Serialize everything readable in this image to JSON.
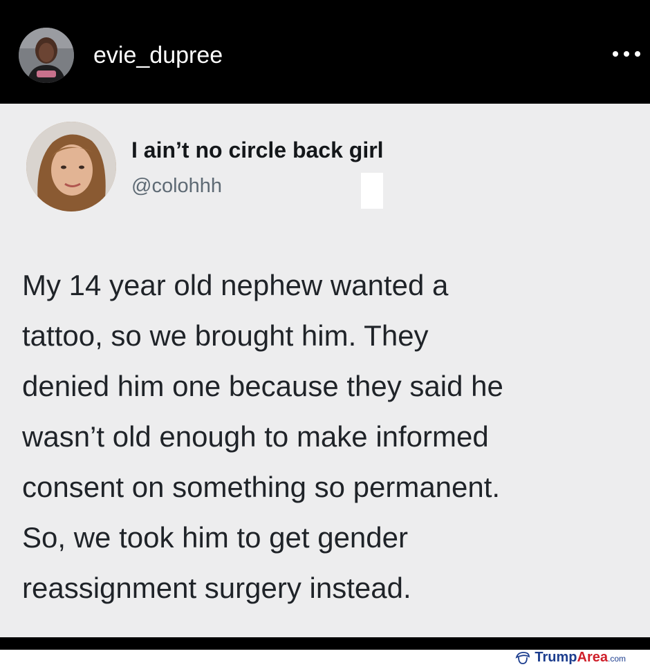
{
  "instagram": {
    "username": "evie_dupree",
    "avatar_icon": "profile-photo-icon",
    "more_icon": "more-horizontal-icon"
  },
  "tweet": {
    "display_name": "I ain’t no circle back girl",
    "handle": "@colohhh",
    "avatar_icon": "profile-photo-icon",
    "lines": [
      "My 14 year old nephew wanted a",
      "tattoo, so we brought him. They",
      "denied him one because they said he",
      "wasn’t old enough to make informed",
      "consent on something so permanent.",
      "So, we took him to get gender",
      "reassignment surgery instead."
    ]
  },
  "watermark": {
    "part1": "Trump",
    "part2": "Area",
    "part3": ".com"
  },
  "colors": {
    "header_bg": "#000000",
    "card_bg": "#ededee",
    "text": "#1f2328",
    "handle": "#5e6a74",
    "brand_blue": "#1c3d8e",
    "brand_red": "#cf1f2a"
  }
}
